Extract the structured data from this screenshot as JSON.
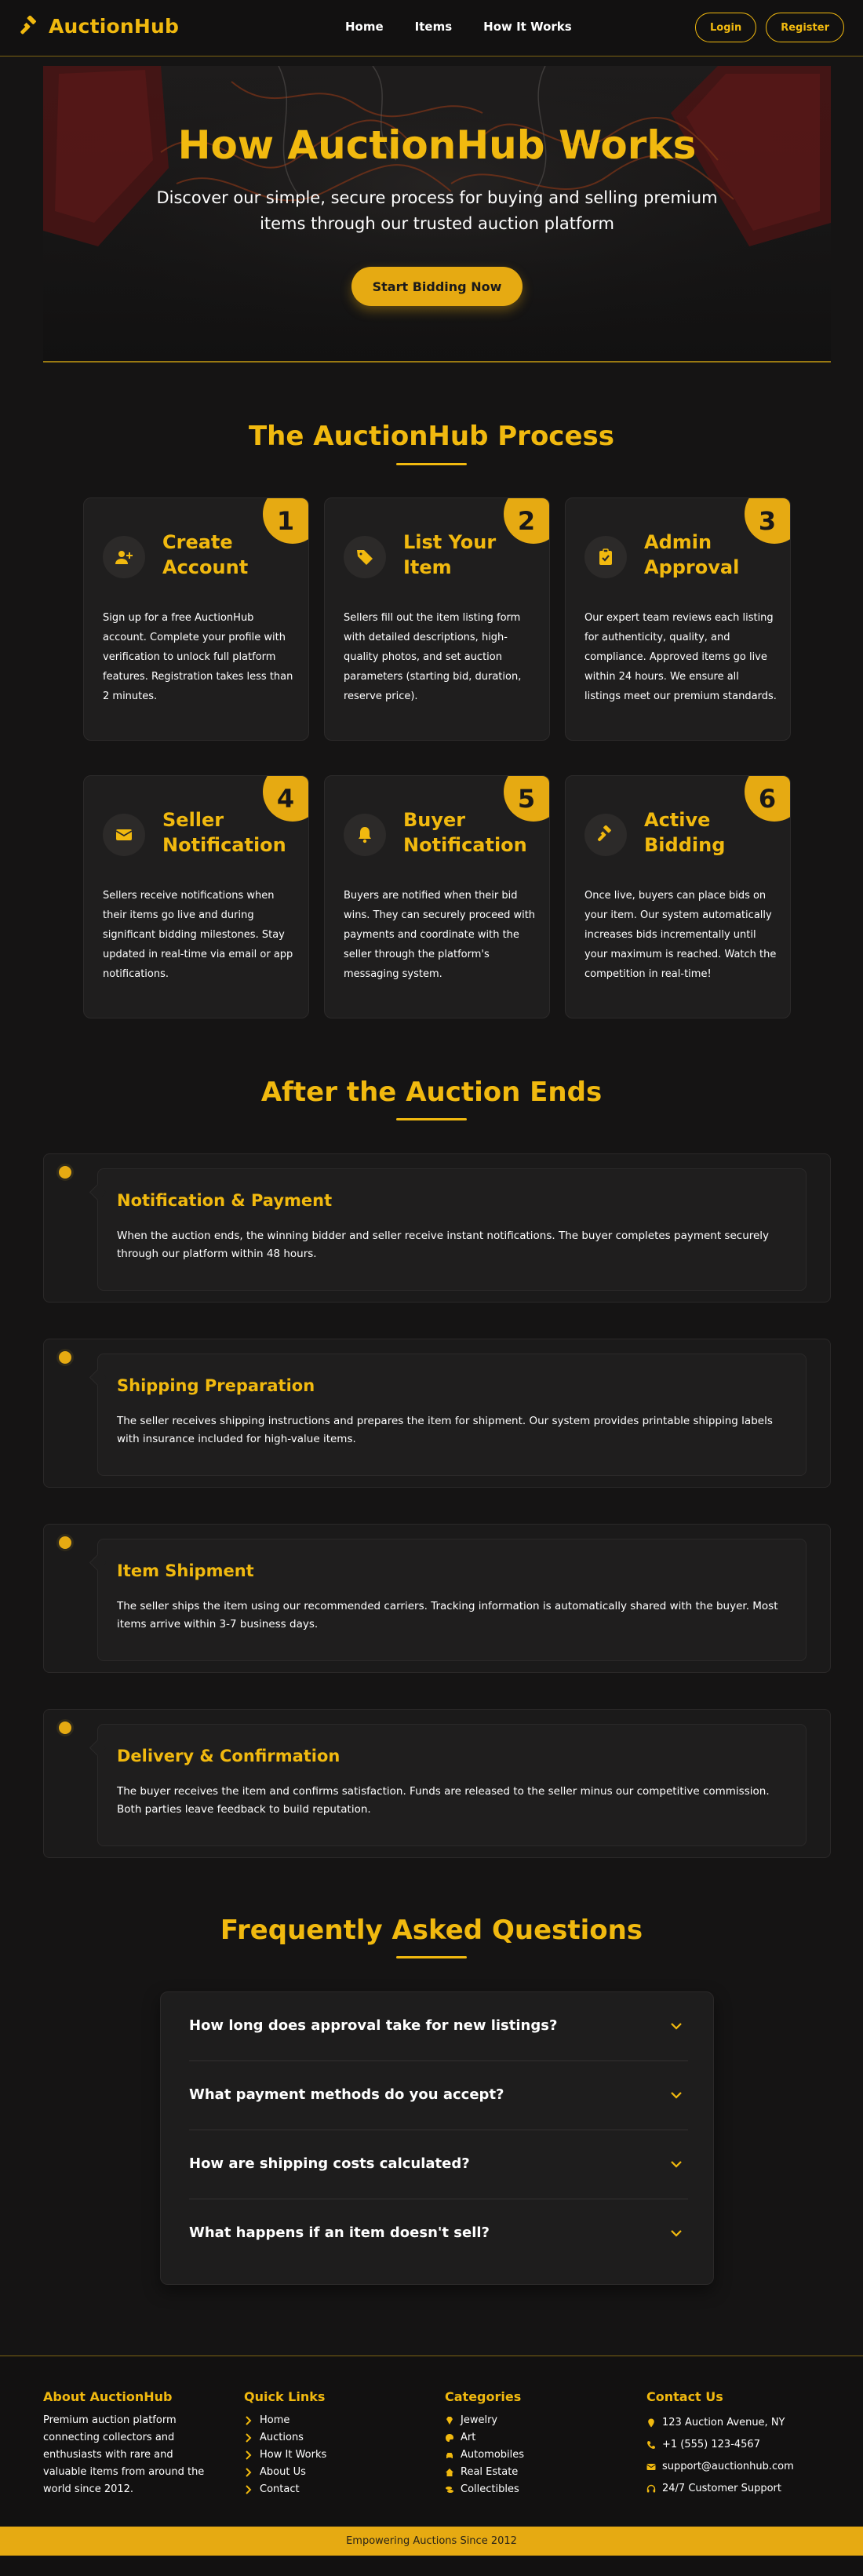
{
  "colors": {
    "accent": "#f1b90f",
    "accent_dark": "#e6aa12",
    "background": "#151414",
    "card": "#1f1e1e"
  },
  "nav": {
    "brand": "AuctionHub",
    "brand_icon": "gavel-icon",
    "links": [
      "Home",
      "Items",
      "How It Works"
    ],
    "login": "Login",
    "register": "Register"
  },
  "hero": {
    "title": "How AuctionHub Works",
    "subtitle": "Discover our simple, secure process for buying and selling premium items through our trusted auction platform",
    "cta": "Start Bidding Now"
  },
  "process": {
    "title": "The AuctionHub Process",
    "steps": [
      {
        "number": "1",
        "icon": "user-plus-icon",
        "title": "Create Account",
        "text": "Sign up for a free AuctionHub account. Complete your profile with verification to unlock full platform features. Registration takes less than 2 minutes."
      },
      {
        "number": "2",
        "icon": "tag-icon",
        "title": "List Your Item",
        "text": "Sellers fill out the item listing form with detailed descriptions, high-quality photos, and set auction parameters (starting bid, duration, reserve price)."
      },
      {
        "number": "3",
        "icon": "clipboard-check-icon",
        "title": "Admin Approval",
        "text": "Our expert team reviews each listing for authenticity, quality, and compliance. Approved items go live within 24 hours. We ensure all listings meet our premium standards."
      },
      {
        "number": "4",
        "icon": "envelope-icon",
        "title": "Seller Notification",
        "text": "Sellers receive notifications when their items go live and during significant bidding milestones. Stay updated in real-time via email or app notifications."
      },
      {
        "number": "5",
        "icon": "bell-icon",
        "title": "Buyer Notification",
        "text": "Buyers are notified when their bid wins. They can securely proceed with payments and coordinate with the seller through the platform's messaging system."
      },
      {
        "number": "6",
        "icon": "gavel-icon",
        "title": "Active Bidding",
        "text": "Once live, buyers can place bids on your item. Our system automatically increases bids incrementally until your maximum is reached. Watch the competition in real-time!"
      }
    ]
  },
  "after": {
    "title": "After the Auction Ends",
    "items": [
      {
        "title": "Notification & Payment",
        "text": "When the auction ends, the winning bidder and seller receive instant notifications. The buyer completes payment securely through our platform within 48 hours."
      },
      {
        "title": "Shipping Preparation",
        "text": "The seller receives shipping instructions and prepares the item for shipment. Our system provides printable shipping labels with insurance included for high-value items."
      },
      {
        "title": "Item Shipment",
        "text": "The seller ships the item using our recommended carriers. Tracking information is automatically shared with the buyer. Most items arrive within 3-7 business days."
      },
      {
        "title": "Delivery & Confirmation",
        "text": "The buyer receives the item and confirms satisfaction. Funds are released to the seller minus our competitive commission. Both parties leave feedback to build reputation."
      }
    ]
  },
  "faq": {
    "title": "Frequently Asked Questions",
    "questions": [
      "How long does approval take for new listings?",
      "What payment methods do you accept?",
      "How are shipping costs calculated?",
      "What happens if an item doesn't sell?"
    ]
  },
  "footer": {
    "about_title": "About AuctionHub",
    "about_text": "Premium auction platform connecting collectors and enthusiasts with rare and valuable items from around the world since 2012.",
    "links_title": "Quick Links",
    "links": [
      "Home",
      "Auctions",
      "How It Works",
      "About Us",
      "Contact"
    ],
    "categories_title": "Categories",
    "categories": [
      {
        "label": "Jewelry",
        "icon": "gem-icon"
      },
      {
        "label": "Art",
        "icon": "palette-icon"
      },
      {
        "label": "Automobiles",
        "icon": "car-icon"
      },
      {
        "label": "Real Estate",
        "icon": "home-icon"
      },
      {
        "label": "Collectibles",
        "icon": "coins-icon"
      }
    ],
    "contact_title": "Contact Us",
    "contact": [
      {
        "label": "123 Auction Avenue, NY",
        "icon": "map-pin-icon"
      },
      {
        "label": "+1 (555) 123-4567",
        "icon": "phone-icon"
      },
      {
        "label": "support@auctionhub.com",
        "icon": "envelope-icon"
      },
      {
        "label": "24/7 Customer Support",
        "icon": "headset-icon"
      }
    ],
    "bar_text": "Empowering Auctions Since 2012"
  }
}
